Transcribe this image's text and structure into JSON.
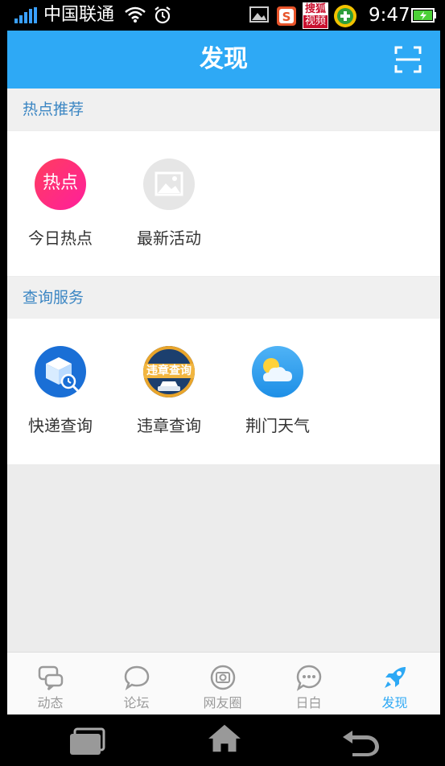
{
  "status_bar": {
    "carrier": "中国联通",
    "time": "9:47",
    "sohu_top": "搜狐",
    "sohu_bottom": "视频"
  },
  "header": {
    "title": "发现",
    "scan_icon": "scan-icon"
  },
  "sections": [
    {
      "title": "热点推荐",
      "items": [
        {
          "label": "今日热点",
          "icon": "hot-icon",
          "icon_text": "热点"
        },
        {
          "label": "最新活动",
          "icon": "image-placeholder-icon"
        }
      ]
    },
    {
      "title": "查询服务",
      "items": [
        {
          "label": "快递查询",
          "icon": "express-box-icon"
        },
        {
          "label": "违章查询",
          "icon": "traffic-violation-icon",
          "icon_text": "违章查询"
        },
        {
          "label": "荆门天气",
          "icon": "weather-icon"
        }
      ]
    }
  ],
  "tabbar": {
    "tabs": [
      {
        "label": "动态",
        "icon": "chat-bubbles-icon",
        "active": false
      },
      {
        "label": "论坛",
        "icon": "chat-bubble-icon",
        "active": false
      },
      {
        "label": "网友圈",
        "icon": "camera-circle-icon",
        "active": false
      },
      {
        "label": "日白",
        "icon": "speech-dots-icon",
        "active": false
      },
      {
        "label": "发现",
        "icon": "rocket-icon",
        "active": true
      }
    ]
  },
  "colors": {
    "accent": "#2ea9f5",
    "section_title": "#3b86c3",
    "tab_inactive": "#9a9a9a"
  }
}
